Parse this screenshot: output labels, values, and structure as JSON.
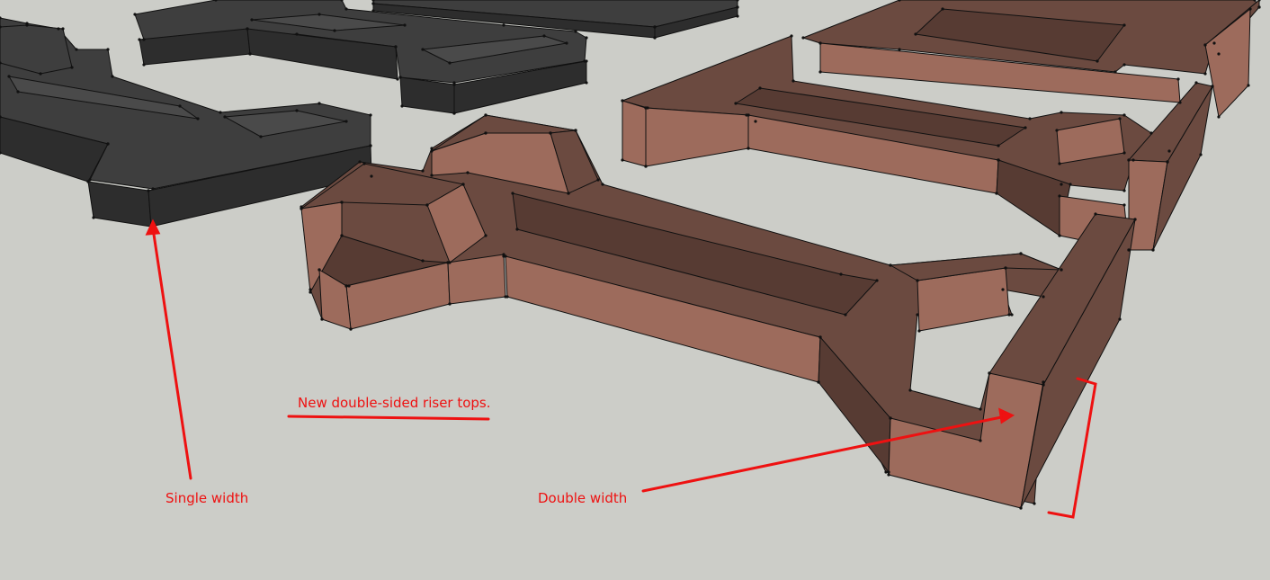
{
  "annotations": {
    "title": "New double-sided riser tops.",
    "single_label": "Single width",
    "double_label": "Double width"
  },
  "colors": {
    "background": "#cccdc8",
    "dark_top": "#3e3e3e",
    "dark_side": "#2d2d2d",
    "dark_inner": "#4a4a4a",
    "copper_front": "#9d6b5c",
    "copper_top": "#6b4a40",
    "copper_inner": "#573b33",
    "edge": "#111111",
    "annotation": "#ee1111"
  }
}
